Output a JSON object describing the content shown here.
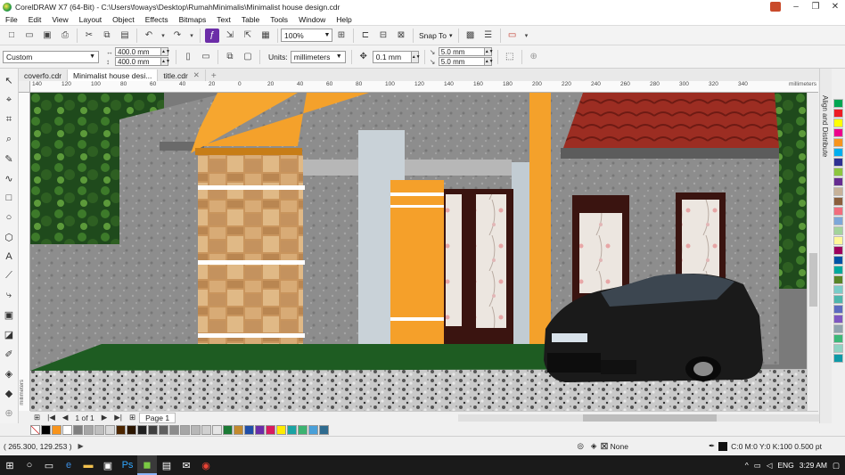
{
  "window": {
    "title": "CorelDRAW X7 (64-Bit) - C:\\Users\\foways\\Desktop\\RumahMinimalis\\Minimalist house design.cdr",
    "controls": [
      "–",
      "❐",
      "✕"
    ]
  },
  "menu": [
    "File",
    "Edit",
    "View",
    "Layout",
    "Object",
    "Effects",
    "Bitmaps",
    "Text",
    "Table",
    "Tools",
    "Window",
    "Help"
  ],
  "toolbar": {
    "zoom": "100%",
    "snap_to": "Snap To"
  },
  "property_bar": {
    "preset": "Custom",
    "width": "400.0 mm",
    "height": "400.0 mm",
    "units_label": "Units:",
    "units": "millimeters",
    "nudge": "0.1 mm",
    "dup_x": "5.0 mm",
    "dup_y": "5.0 mm"
  },
  "doc_tabs": [
    {
      "label": "coverfo.cdr",
      "active": false
    },
    {
      "label": "Minimalist house desi...",
      "active": true
    },
    {
      "label": "title.cdr",
      "active": false
    }
  ],
  "ruler": {
    "ticks": [
      "140",
      "120",
      "100",
      "80",
      "60",
      "40",
      "20",
      "0",
      "20",
      "40",
      "60",
      "80",
      "100",
      "120",
      "140",
      "160",
      "180",
      "200",
      "220",
      "240",
      "260",
      "280",
      "300",
      "320",
      "340"
    ],
    "units_label": "millimeters",
    "v_units_label": "millimeters"
  },
  "page_nav": {
    "count": "1 of 1",
    "page_tab": "Page 1"
  },
  "docker": {
    "label": "Align and Distribute"
  },
  "status": {
    "coords": "( 265.300, 129.253 )",
    "fill_none": "None",
    "outline": "C:0 M:0 Y:0 K:100  0.500 pt"
  },
  "taskbar": {
    "time": "3:29 AM",
    "language": "ENG"
  },
  "colors": {
    "palette": [
      "#000000",
      "#f7941d",
      "#ffffff",
      "#7f7f7f",
      "#a6a6a6",
      "#bfbfbf",
      "#d9d9d9",
      "#4d2600",
      "#2b1600",
      "#1f1f1f",
      "#3f3f3f",
      "#5f5f5f",
      "#8c8c8c",
      "#a6a6a6",
      "#b7b7b7",
      "#d0d0d0",
      "#e5e5e5",
      "#1b7a35",
      "#c28a2e",
      "#1f4ea8",
      "#6a2da8",
      "#d81b60",
      "#ffeb00",
      "#1aa3a3",
      "#3cb371",
      "#4aa0d8",
      "#2f6b8f"
    ],
    "side_palette": [
      "#00a651",
      "#ed1c24",
      "#ffff00",
      "#ec008c",
      "#f7941d",
      "#00aeef",
      "#2e3192",
      "#8dc63f",
      "#662d91",
      "#c7b299",
      "#8b5e3c",
      "#f26d7d",
      "#7da7d9",
      "#a3d39c",
      "#fff799",
      "#9e005d",
      "#0054a6",
      "#00a99d",
      "#598527",
      "#7accc8",
      "#4db6ac",
      "#5c6bc0",
      "#7e57c2",
      "#90a4ae",
      "#3cb878",
      "#8fd3c3",
      "#0e9aa7"
    ]
  }
}
